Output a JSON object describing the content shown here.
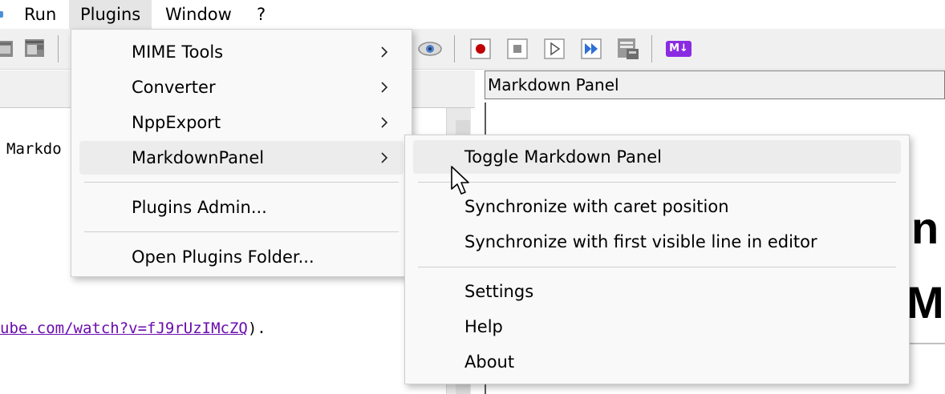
{
  "menubar": {
    "items": [
      {
        "label": "Run"
      },
      {
        "label": "Plugins"
      },
      {
        "label": "Window"
      },
      {
        "label": "?"
      }
    ]
  },
  "toolbar": {
    "icons": [
      "close-icon",
      "close-all-icon",
      "eye-icon",
      "record-macro-icon",
      "stop-recording-icon",
      "play-macro-icon",
      "run-macro-multiple-icon",
      "save-macro-icon",
      "markdown-icon"
    ],
    "markdown_badge": "M↓"
  },
  "editor": {
    "line1": "Markdo",
    "line2_link": "ube.com/watch?v=fJ9rUzIMcZQ",
    "line2_tail": ")."
  },
  "right_panel": {
    "title": "Markdown Panel",
    "fragment1": "n",
    "fragment2": "M"
  },
  "plugins_menu": {
    "items": [
      {
        "label": "MIME Tools",
        "submenu": true
      },
      {
        "label": "Converter",
        "submenu": true
      },
      {
        "label": "NppExport",
        "submenu": true
      },
      {
        "label": "MarkdownPanel",
        "submenu": true,
        "highlighted": true
      },
      {
        "label": "Plugins Admin..."
      },
      {
        "label": "Open Plugins Folder..."
      }
    ]
  },
  "markdownpanel_submenu": {
    "items": [
      {
        "label": "Toggle Markdown Panel",
        "highlighted": true
      },
      {
        "label": "Synchronize with caret position"
      },
      {
        "label": "Synchronize with first visible line in editor"
      },
      {
        "label": "Settings"
      },
      {
        "label": "Help"
      },
      {
        "label": "About"
      }
    ]
  },
  "colors": {
    "menu_bg": "#f9f9f9",
    "hover": "#ececec",
    "record_red": "#c00000",
    "link": "#6a0dad",
    "markdown_purple": "#8a2be2"
  }
}
